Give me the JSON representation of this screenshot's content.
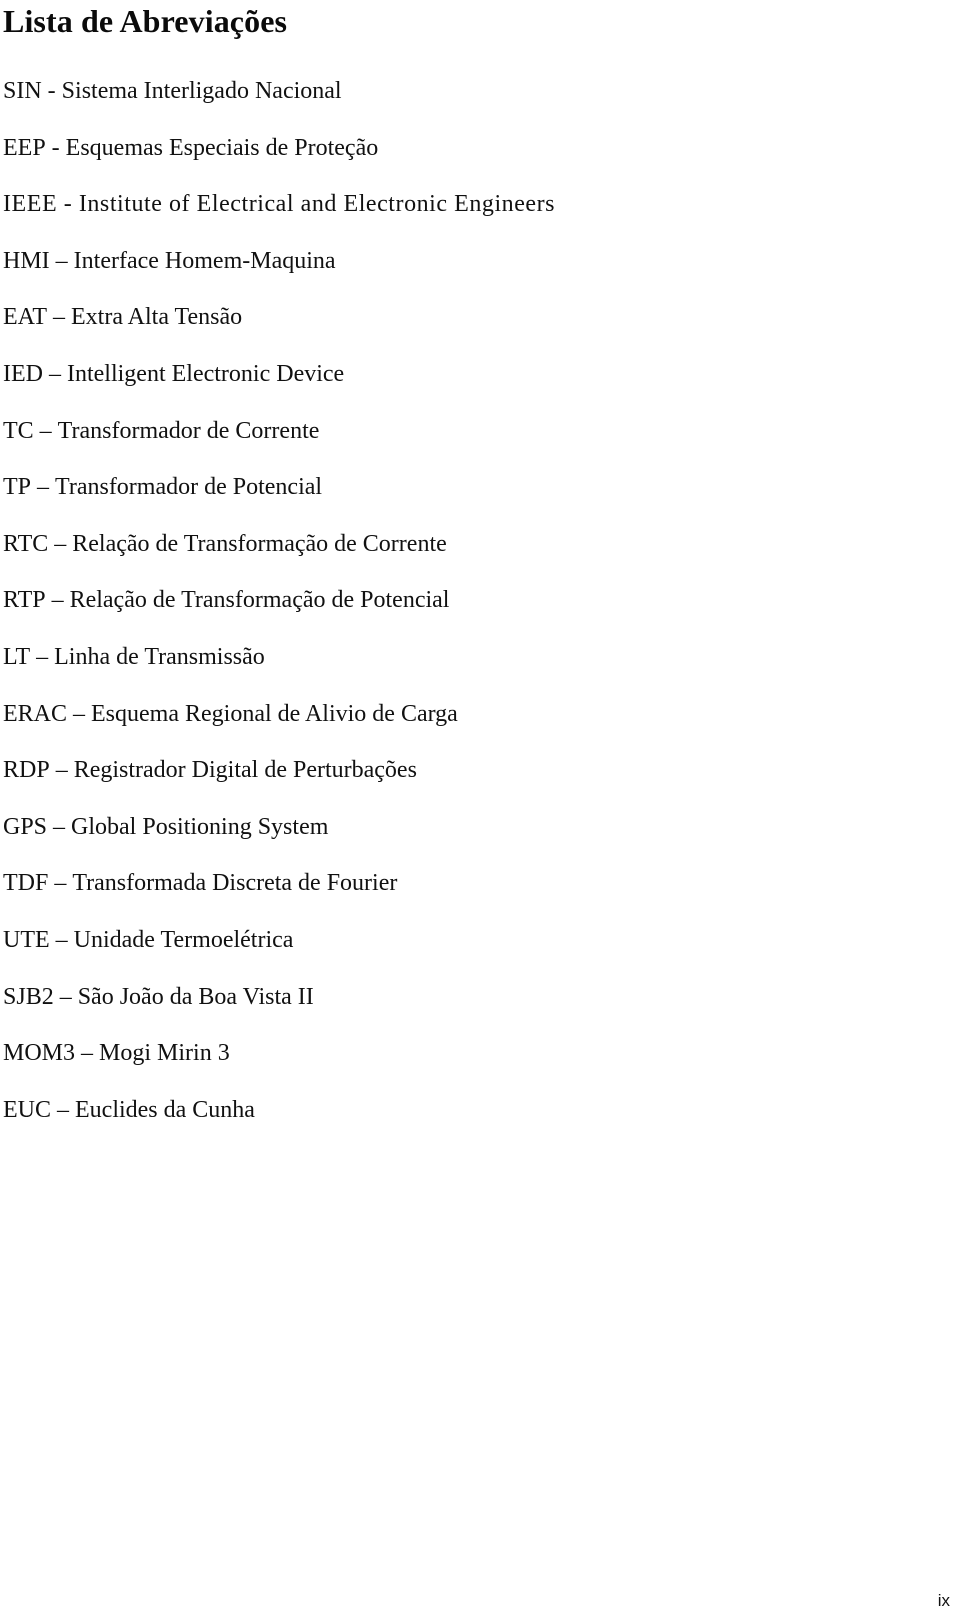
{
  "document": {
    "title": "Lista de Abreviações",
    "page_number": "ix"
  },
  "abbreviations": [
    {
      "term": "SIN",
      "separator": " - ",
      "definition": "Sistema Interligado Nacional"
    },
    {
      "term": "EEP",
      "separator": " - ",
      "definition": "Esquemas Especiais de Proteção"
    },
    {
      "term": "IEEE",
      "separator": " - ",
      "definition": "Institute of Electrical and Electronic Engineers"
    },
    {
      "term": "HMI",
      "separator": " – ",
      "definition": "Interface Homem-Maquina"
    },
    {
      "term": "EAT",
      "separator": " – ",
      "definition": "Extra Alta Tensão"
    },
    {
      "term": "IED",
      "separator": " – ",
      "definition": "Intelligent Electronic Device"
    },
    {
      "term": "TC",
      "separator": " – ",
      "definition": "Transformador de Corrente"
    },
    {
      "term": "TP",
      "separator": " – ",
      "definition": "Transformador de Potencial"
    },
    {
      "term": "RTC",
      "separator": " – ",
      "definition": "Relação de Transformação de Corrente"
    },
    {
      "term": "RTP",
      "separator": " – ",
      "definition": "Relação de Transformação de Potencial"
    },
    {
      "term": "LT",
      "separator": " – ",
      "definition": "Linha de Transmissão"
    },
    {
      "term": "ERAC",
      "separator": " – ",
      "definition": "Esquema Regional de Alivio de Carga"
    },
    {
      "term": "RDP",
      "separator": " – ",
      "definition": "Registrador Digital de Perturbações"
    },
    {
      "term": "GPS",
      "separator": " – ",
      "definition": "Global Positioning System"
    },
    {
      "term": "TDF",
      "separator": " – ",
      "definition": "Transformada Discreta de Fourier"
    },
    {
      "term": "UTE",
      "separator": " – ",
      "definition": "Unidade Termoelétrica"
    },
    {
      "term": "SJB2",
      "separator": " – ",
      "definition": "São João da Boa Vista II"
    },
    {
      "term": "MOM3",
      "separator": " – ",
      "definition": "Mogi Mirin 3"
    },
    {
      "term": "EUC",
      "separator": " – ",
      "definition": "Euclides da Cunha"
    }
  ]
}
